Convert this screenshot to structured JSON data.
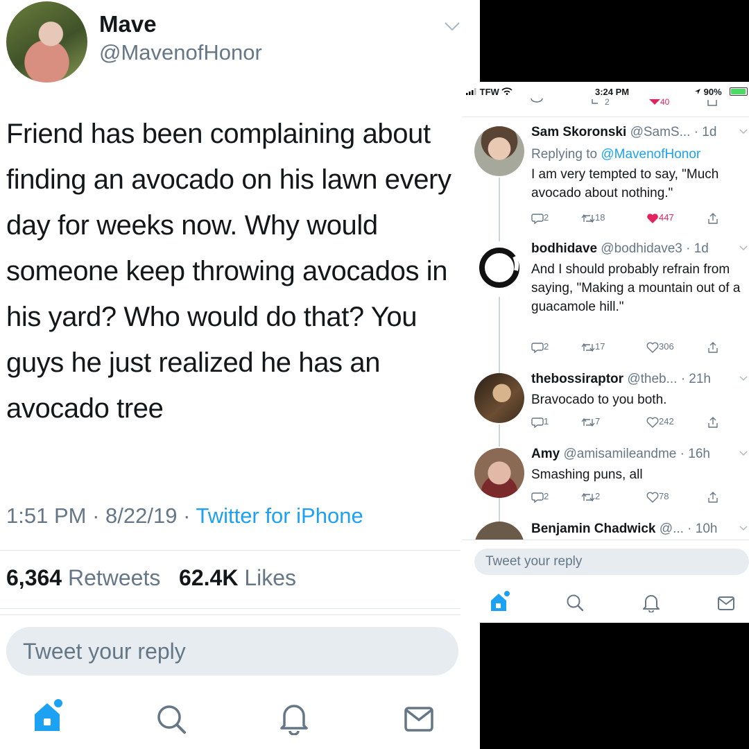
{
  "main_tweet": {
    "author_name": "Mave",
    "author_handle": "@MavenofHonor",
    "text": "Friend has been complaining about finding an avocado on his lawn every day for weeks now. Why would someone keep throwing avocados in his yard? Who would do that? You guys he just realized he has an avocado tree",
    "time": "1:51 PM",
    "date": "8/22/19",
    "source": "Twitter for iPhone",
    "retweets_count": "6,364",
    "retweets_label": "Retweets",
    "likes_count": "62.4K",
    "likes_label": "Likes",
    "reply_placeholder": "Tweet your reply"
  },
  "nav_icons": [
    "home-icon",
    "search-icon",
    "notifications-icon",
    "messages-icon"
  ],
  "phone": {
    "status_bar": {
      "carrier": "TFW",
      "time": "3:24 PM",
      "battery": "90%"
    },
    "cut_off_row": {
      "retweets": "2",
      "likes": "40"
    },
    "replies": [
      {
        "name": "Sam Skoronski",
        "handle_time": "@SamS... · 1d",
        "replying_prefix": "Replying to",
        "replying_to": "@MavenofHonor",
        "text": "I am very tempted to say, \"Much avocado about nothing.\"",
        "replies": "2",
        "retweets": "18",
        "likes": "447",
        "liked": true
      },
      {
        "name": "bodhidave",
        "handle_time": "@bodhidave3 · 1d",
        "text": "And I should probably refrain from saying, \"Making a mountain out of a guacamole hill.\"",
        "replies": "2",
        "retweets": "17",
        "likes": "306",
        "liked": false
      },
      {
        "name": "thebossiraptor",
        "handle_time": "@theb... · 21h",
        "text": "Bravocado to you both.",
        "replies": "1",
        "retweets": "7",
        "likes": "242",
        "liked": false
      },
      {
        "name": "Amy",
        "handle_time": "@amisamileandme · 16h",
        "text": "Smashing puns, all",
        "replies": "2",
        "retweets": "2",
        "likes": "78",
        "liked": false
      },
      {
        "name": "Benjamin Chadwick",
        "handle_time": "@... · 10h"
      }
    ],
    "reply_placeholder": "Tweet your reply"
  },
  "colors": {
    "accent": "#1da1f2",
    "like": "#e0245e",
    "muted": "#657786"
  }
}
